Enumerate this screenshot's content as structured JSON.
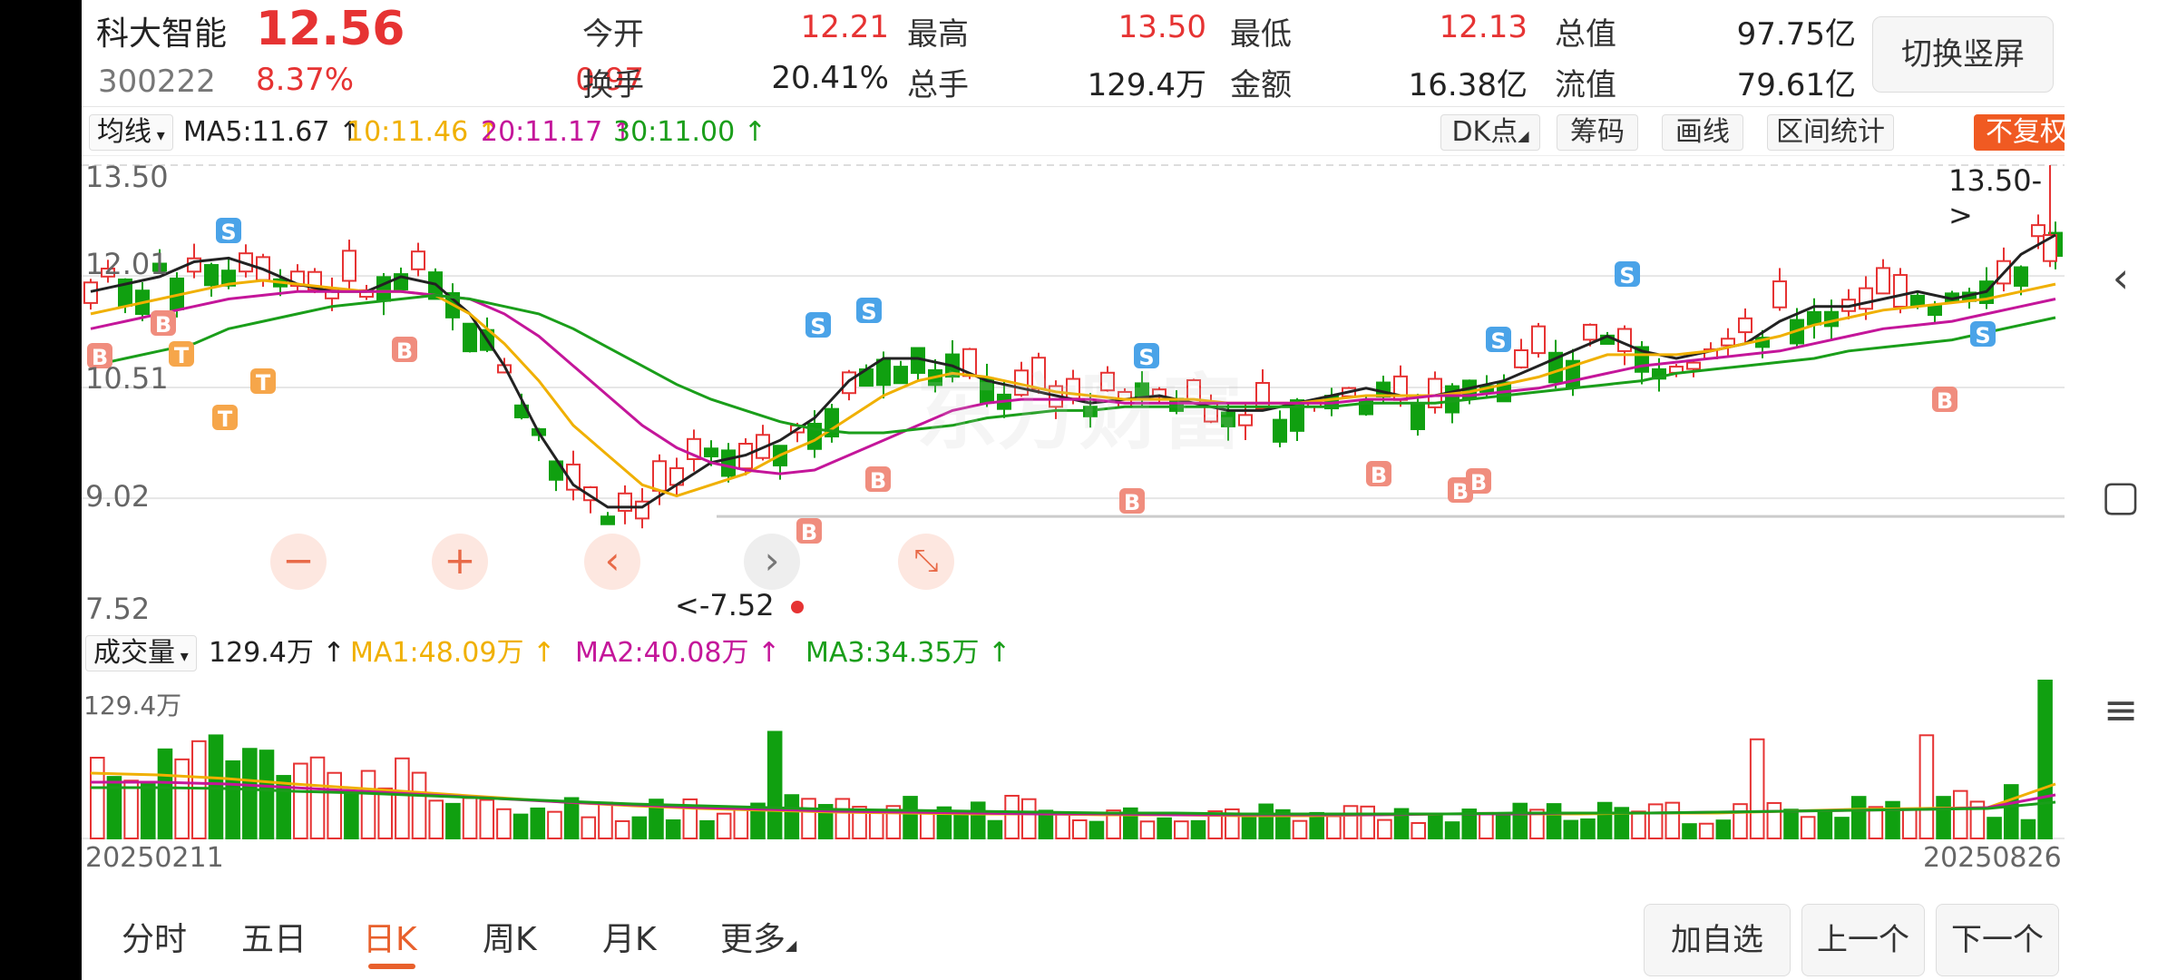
{
  "stock": {
    "name": "科大智能",
    "price": "12.56",
    "code": "300222",
    "pct": "8.37%",
    "change": "0.97"
  },
  "quote": [
    {
      "label": "今开",
      "value": "12.21",
      "color": "red"
    },
    {
      "label": "最高",
      "value": "13.50",
      "color": "red"
    },
    {
      "label": "最低",
      "value": "12.13",
      "color": "red"
    },
    {
      "label": "总值",
      "value": "97.75亿",
      "color": "dark"
    },
    {
      "label": "换手",
      "value": "20.41%",
      "color": "dark"
    },
    {
      "label": "总手",
      "value": "129.4万",
      "color": "dark"
    },
    {
      "label": "金额",
      "value": "16.38亿",
      "color": "dark"
    },
    {
      "label": "流值",
      "value": "79.61亿",
      "color": "dark"
    }
  ],
  "switch_label": "切换竖屏",
  "ma_bar": {
    "select": "均线",
    "ma5": "MA5:11.67 ↑",
    "ma10": "10:11.46 ↑",
    "ma20": "20:11.17 ↑",
    "ma30": "30:11.00 ↑",
    "colors": {
      "ma5": "#222222",
      "ma10": "#f0b000",
      "ma20": "#c4169a",
      "ma30": "#1a9e1a"
    },
    "tools": [
      "DK点",
      "筹码",
      "画线",
      "区间统计"
    ],
    "fuquan": "不复权"
  },
  "price_axis": [
    "13.50",
    "12.01",
    "10.51",
    "9.02",
    "7.52"
  ],
  "high_marker": "13.50->",
  "low_marker": "<-7.52",
  "watermark": "东方财富",
  "controls": [
    "−",
    "+",
    "‹",
    "›",
    "⤡"
  ],
  "volume_bar": {
    "select": "成交量",
    "vol": "129.4万 ↑",
    "ma1": "MA1:48.09万 ↑",
    "ma2": "MA2:40.08万 ↑",
    "ma3": "MA3:34.35万 ↑",
    "max_label": "129.4万",
    "colors": {
      "ma1": "#f0b000",
      "ma2": "#c4169a",
      "ma3": "#1a9e1a"
    }
  },
  "dates": {
    "start": "20250211",
    "end": "20250826"
  },
  "tabs": [
    "分时",
    "五日",
    "日K",
    "周K",
    "月K",
    "更多"
  ],
  "active_tab": "日K",
  "bottom_buttons": [
    "加自选",
    "上一个",
    "下一个"
  ],
  "marker_letters": {
    "buy": "B",
    "sell": "S",
    "t": "T"
  },
  "nav_icons": [
    "back-icon",
    "recent-apps-icon",
    "menu-icon"
  ],
  "chart_data": {
    "type": "candlestick",
    "ylim": [
      7.52,
      13.5
    ],
    "series": [
      {
        "name": "MA5",
        "values": [
          11.8,
          11.9,
          12.0,
          12.2,
          12.25,
          12.1,
          11.9,
          11.8,
          11.8,
          12.0,
          11.9,
          11.5,
          10.8,
          9.9,
          9.2,
          8.9,
          8.9,
          9.2,
          9.5,
          9.6,
          9.8,
          10.1,
          10.6,
          10.9,
          10.9,
          10.8,
          10.6,
          10.5,
          10.4,
          10.3,
          10.35,
          10.4,
          10.3,
          10.2,
          10.2,
          10.3,
          10.4,
          10.5,
          10.4,
          10.4,
          10.5,
          10.6,
          10.8,
          11.0,
          11.2,
          11.0,
          10.9,
          11.0,
          11.1,
          11.4,
          11.6,
          11.6,
          11.7,
          11.8,
          11.7,
          11.8,
          12.3,
          12.56
        ]
      },
      {
        "name": "MA10",
        "values": [
          11.5,
          11.6,
          11.7,
          11.8,
          11.9,
          11.95,
          11.9,
          11.85,
          11.8,
          11.8,
          11.75,
          11.5,
          11.1,
          10.6,
          10.0,
          9.6,
          9.2,
          9.05,
          9.2,
          9.35,
          9.6,
          9.8,
          10.1,
          10.4,
          10.6,
          10.7,
          10.65,
          10.55,
          10.45,
          10.4,
          10.35,
          10.35,
          10.35,
          10.3,
          10.3,
          10.3,
          10.35,
          10.4,
          10.4,
          10.4,
          10.45,
          10.55,
          10.65,
          10.8,
          10.95,
          10.95,
          10.95,
          11.0,
          11.1,
          11.2,
          11.35,
          11.45,
          11.55,
          11.6,
          11.65,
          11.7,
          11.8,
          11.9
        ]
      },
      {
        "name": "MA20",
        "values": [
          11.3,
          11.4,
          11.5,
          11.6,
          11.7,
          11.75,
          11.8,
          11.8,
          11.8,
          11.8,
          11.75,
          11.7,
          11.5,
          11.2,
          10.8,
          10.4,
          10.0,
          9.7,
          9.5,
          9.4,
          9.35,
          9.4,
          9.6,
          9.8,
          10.0,
          10.2,
          10.3,
          10.35,
          10.35,
          10.35,
          10.3,
          10.3,
          10.3,
          10.3,
          10.3,
          10.3,
          10.3,
          10.35,
          10.35,
          10.4,
          10.4,
          10.45,
          10.5,
          10.6,
          10.7,
          10.8,
          10.85,
          10.9,
          10.95,
          11.0,
          11.1,
          11.2,
          11.3,
          11.35,
          11.4,
          11.5,
          11.6,
          11.7
        ]
      },
      {
        "name": "MA30",
        "values": [
          10.8,
          10.9,
          11.0,
          11.1,
          11.3,
          11.4,
          11.5,
          11.6,
          11.65,
          11.7,
          11.75,
          11.7,
          11.6,
          11.5,
          11.3,
          11.05,
          10.8,
          10.55,
          10.35,
          10.2,
          10.05,
          9.95,
          9.9,
          9.9,
          9.95,
          10.0,
          10.1,
          10.15,
          10.2,
          10.2,
          10.25,
          10.25,
          10.25,
          10.25,
          10.25,
          10.25,
          10.25,
          10.3,
          10.3,
          10.3,
          10.35,
          10.4,
          10.45,
          10.5,
          10.55,
          10.6,
          10.7,
          10.75,
          10.8,
          10.85,
          10.9,
          11.0,
          11.05,
          11.1,
          11.15,
          11.25,
          11.35,
          11.45
        ]
      }
    ]
  }
}
